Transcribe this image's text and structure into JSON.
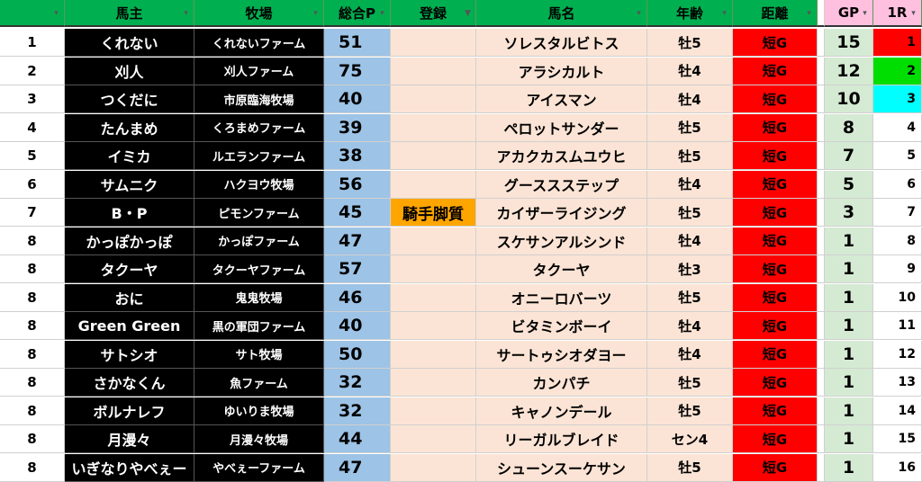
{
  "headers": {
    "rank": "",
    "owner": "馬主",
    "farm": "牧場",
    "total": "総合P",
    "register": "登録",
    "horse": "馬名",
    "age": "年齢",
    "distance": "距離",
    "gp": "GP",
    "round1": "1R"
  },
  "rows": [
    {
      "rank": "1",
      "owner": "くれない",
      "farm": "くれないファーム",
      "total": "51",
      "register": "",
      "horse": "ソレスタルビトス",
      "age": "牡5",
      "distance": "短G",
      "gp": "15",
      "r1": "1",
      "r1_color": "#ff0000"
    },
    {
      "rank": "2",
      "owner": "刈人",
      "farm": "刈人ファーム",
      "total": "75",
      "register": "",
      "horse": "アラシカルト",
      "age": "牡4",
      "distance": "短G",
      "gp": "12",
      "r1": "2",
      "r1_color": "#00dd00"
    },
    {
      "rank": "3",
      "owner": "つくだに",
      "farm": "市原臨海牧場",
      "total": "40",
      "register": "",
      "horse": "アイスマン",
      "age": "牡4",
      "distance": "短G",
      "gp": "10",
      "r1": "3",
      "r1_color": "#00ffff"
    },
    {
      "rank": "4",
      "owner": "たんまめ",
      "farm": "くろまめファーム",
      "total": "39",
      "register": "",
      "horse": "ペロットサンダー",
      "age": "牡5",
      "distance": "短G",
      "gp": "8",
      "r1": "4",
      "r1_color": ""
    },
    {
      "rank": "5",
      "owner": "イミカ",
      "farm": "ルエランファーム",
      "total": "38",
      "register": "",
      "horse": "アカクカスムユウヒ",
      "age": "牡5",
      "distance": "短G",
      "gp": "7",
      "r1": "5",
      "r1_color": ""
    },
    {
      "rank": "6",
      "owner": "サムニク",
      "farm": "ハクヨウ牧場",
      "total": "56",
      "register": "",
      "horse": "グーススステップ",
      "age": "牡4",
      "distance": "短G",
      "gp": "5",
      "r1": "6",
      "r1_color": ""
    },
    {
      "rank": "7",
      "owner": "B・P",
      "farm": "ピモンファーム",
      "total": "45",
      "register": "騎手脚質",
      "horse": "カイザーライジング",
      "age": "牡5",
      "distance": "短G",
      "gp": "3",
      "r1": "7",
      "r1_color": ""
    },
    {
      "rank": "8",
      "owner": "かっぽかっぽ",
      "farm": "かっぽファーム",
      "total": "47",
      "register": "",
      "horse": "スケサンアルシンド",
      "age": "牡4",
      "distance": "短G",
      "gp": "1",
      "r1": "8",
      "r1_color": ""
    },
    {
      "rank": "8",
      "owner": "タクーヤ",
      "farm": "タクーヤファーム",
      "total": "57",
      "register": "",
      "horse": "タクーヤ",
      "age": "牡3",
      "distance": "短G",
      "gp": "1",
      "r1": "9",
      "r1_color": ""
    },
    {
      "rank": "8",
      "owner": "おに",
      "farm": "鬼鬼牧場",
      "total": "46",
      "register": "",
      "horse": "オニーロバーツ",
      "age": "牡5",
      "distance": "短G",
      "gp": "1",
      "r1": "10",
      "r1_color": ""
    },
    {
      "rank": "8",
      "owner": "Green Green",
      "farm": "黒の軍団ファーム",
      "total": "40",
      "register": "",
      "horse": "ビタミンボーイ",
      "age": "牡4",
      "distance": "短G",
      "gp": "1",
      "r1": "11",
      "r1_color": ""
    },
    {
      "rank": "8",
      "owner": "サトシオ",
      "farm": "サト牧場",
      "total": "50",
      "register": "",
      "horse": "サートゥシオダヨー",
      "age": "牡4",
      "distance": "短G",
      "gp": "1",
      "r1": "12",
      "r1_color": ""
    },
    {
      "rank": "8",
      "owner": "さかなくん",
      "farm": "魚ファーム",
      "total": "32",
      "register": "",
      "horse": "カンパチ",
      "age": "牡5",
      "distance": "短G",
      "gp": "1",
      "r1": "13",
      "r1_color": ""
    },
    {
      "rank": "8",
      "owner": "ボルナレフ",
      "farm": "ゆいりま牧場",
      "total": "32",
      "register": "",
      "horse": "キャノンデール",
      "age": "牡5",
      "distance": "短G",
      "gp": "1",
      "r1": "14",
      "r1_color": ""
    },
    {
      "rank": "8",
      "owner": "月漫々",
      "farm": "月漫々牧場",
      "total": "44",
      "register": "",
      "horse": "リーガルブレイド",
      "age": "セン4",
      "distance": "短G",
      "gp": "1",
      "r1": "15",
      "r1_color": ""
    },
    {
      "rank": "8",
      "owner": "いぎなりやべぇー",
      "farm": "やべぇーファーム",
      "total": "47",
      "register": "",
      "horse": "シューンスーケサン",
      "age": "牡5",
      "distance": "短G",
      "gp": "1",
      "r1": "16",
      "r1_color": ""
    }
  ],
  "icons": {
    "filter": "filter-dropdown-icon",
    "filter_active": "filter-active-icon"
  }
}
